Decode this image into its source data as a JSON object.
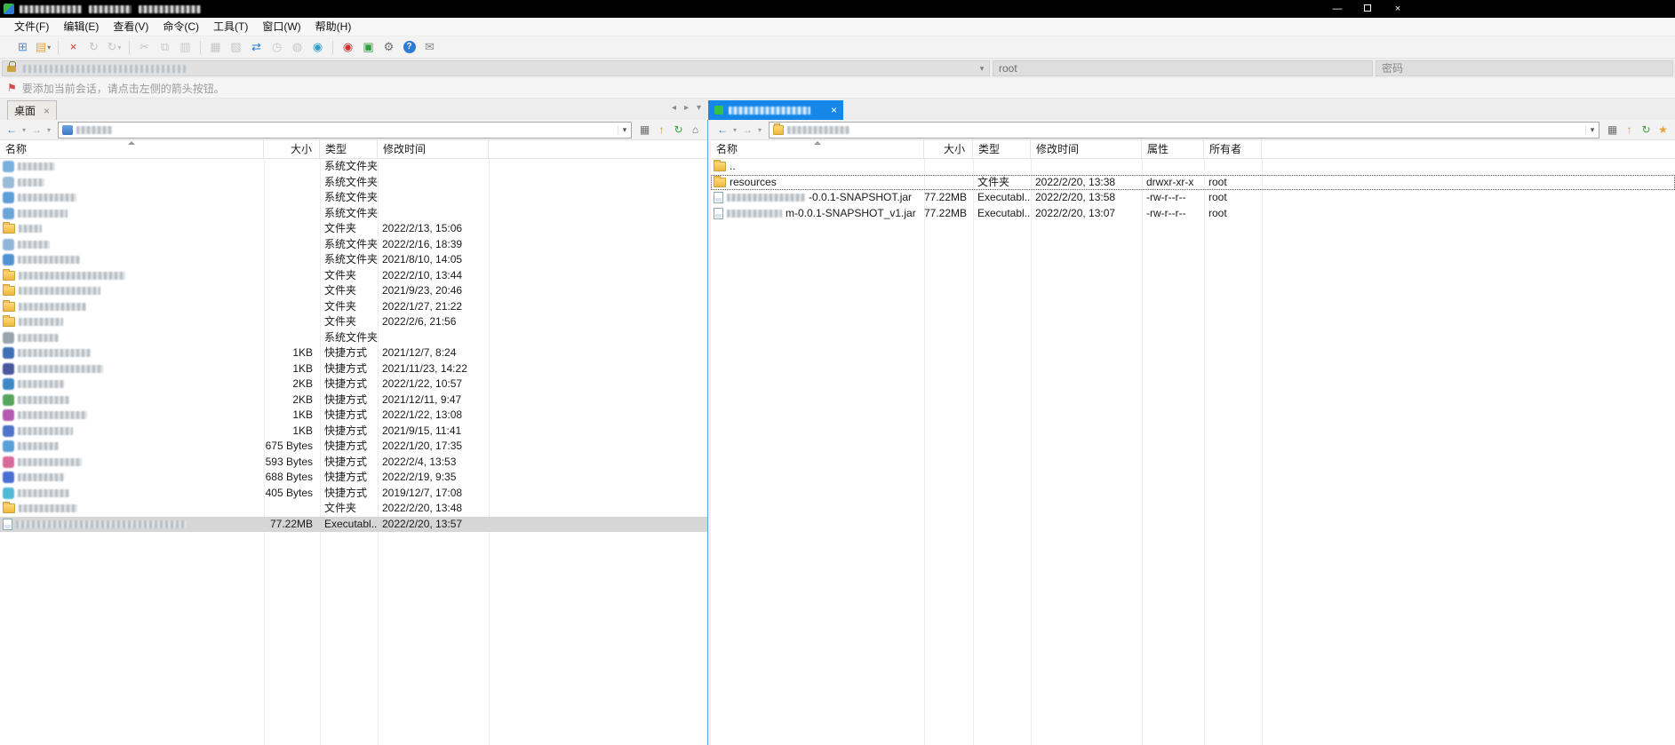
{
  "window": {
    "controls": {
      "minimize": "—",
      "maximize": "",
      "close": "×"
    }
  },
  "menu": [
    "文件(F)",
    "编辑(E)",
    "查看(V)",
    "命令(C)",
    "工具(T)",
    "窗口(W)",
    "帮助(H)"
  ],
  "toolbar": {
    "items": [
      {
        "name": "new-session-button",
        "glyph": "⊞",
        "color": "#4a8fd4",
        "enabled": true
      },
      {
        "name": "open-session-button",
        "glyph": "▤",
        "color": "#dfa93e",
        "enabled": true,
        "dropdown": true
      },
      {
        "separator": true
      },
      {
        "name": "disconnect-button",
        "glyph": "×",
        "color": "#cc3333",
        "enabled": true
      },
      {
        "name": "reconnect-button",
        "glyph": "↻",
        "color": "#8a8a8a",
        "enabled": false
      },
      {
        "name": "reconnect-all-button",
        "glyph": "↻",
        "color": "#8a8a8a",
        "enabled": false,
        "dropdown": true
      },
      {
        "separator": true
      },
      {
        "name": "cut-button",
        "glyph": "✂",
        "color": "#8a8a8a",
        "enabled": false
      },
      {
        "name": "copy-button",
        "glyph": "⧉",
        "color": "#8a8a8a",
        "enabled": false
      },
      {
        "name": "paste-button",
        "glyph": "▥",
        "color": "#8a8a8a",
        "enabled": false
      },
      {
        "separator": true
      },
      {
        "name": "properties-button",
        "glyph": "▦",
        "color": "#8a8a8a",
        "enabled": false
      },
      {
        "name": "compare-button",
        "glyph": "▧",
        "color": "#8a8a8a",
        "enabled": false
      },
      {
        "name": "transfer-button",
        "glyph": "⇄",
        "color": "#2e7bd4",
        "enabled": true
      },
      {
        "name": "transfer-queue-button",
        "glyph": "◷",
        "color": "#8a8a8a",
        "enabled": false
      },
      {
        "name": "log-button",
        "glyph": "◍",
        "color": "#8a8a8a",
        "enabled": false
      },
      {
        "name": "synchronize-button",
        "glyph": "◉",
        "color": "#2e9ed4",
        "enabled": true
      },
      {
        "separator": true
      },
      {
        "name": "record-button",
        "glyph": "◉",
        "color": "#cc3333",
        "enabled": true
      },
      {
        "name": "secure-mode-button",
        "glyph": "▣",
        "color": "#2e9e3e",
        "enabled": true
      },
      {
        "name": "options-button",
        "glyph": "⚙",
        "color": "#6e6e6e",
        "enabled": true
      },
      {
        "name": "help-button",
        "glyph": "?",
        "color": "#ffffff",
        "bg": "#2e7bd4",
        "enabled": true
      },
      {
        "name": "feedback-button",
        "glyph": "✉",
        "color": "#8a8a8a",
        "enabled": true
      }
    ]
  },
  "quick_connect": {
    "username": "root",
    "password_placeholder": "密码"
  },
  "notice": {
    "text": "要添加当前会话，请点击左侧的箭头按钮。"
  },
  "tabs": {
    "desktop_label": "桌面"
  },
  "left_pane": {
    "columns": [
      "名称",
      "大小",
      "类型",
      "修改时间"
    ],
    "rows": [
      {
        "icon": "app",
        "color": "#7ab0e0",
        "nrw": 42,
        "size": "",
        "type": "系统文件夹",
        "mtime": ""
      },
      {
        "icon": "app",
        "color": "#9bbbd8",
        "nrw": 30,
        "size": "",
        "type": "系统文件夹",
        "mtime": ""
      },
      {
        "icon": "app",
        "color": "#5e9ed6",
        "nrw": 66,
        "size": "",
        "type": "系统文件夹",
        "mtime": ""
      },
      {
        "icon": "app",
        "color": "#6aa5d8",
        "nrw": 56,
        "size": "",
        "type": "系统文件夹",
        "mtime": ""
      },
      {
        "icon": "folder",
        "nrw": 26,
        "size": "",
        "type": "文件夹",
        "mtime": "2022/2/13, 15:06"
      },
      {
        "icon": "app",
        "color": "#8fb6d9",
        "nrw": 36,
        "size": "",
        "type": "系统文件夹",
        "mtime": "2022/2/16, 18:39"
      },
      {
        "icon": "app",
        "color": "#4f93cf",
        "nrw": 70,
        "size": "",
        "type": "系统文件夹",
        "mtime": "2021/8/10, 14:05"
      },
      {
        "icon": "folder",
        "nrw": 120,
        "size": "",
        "type": "文件夹",
        "mtime": "2022/2/10, 13:44"
      },
      {
        "icon": "folder",
        "nrw": 92,
        "size": "",
        "type": "文件夹",
        "mtime": "2021/9/23, 20:46"
      },
      {
        "icon": "folder",
        "nrw": 76,
        "size": "",
        "type": "文件夹",
        "mtime": "2022/1/27, 21:22"
      },
      {
        "icon": "folder",
        "nrw": 50,
        "size": "",
        "type": "文件夹",
        "mtime": "2022/2/6, 21:56"
      },
      {
        "icon": "app",
        "color": "#9aa4ad",
        "nrw": 46,
        "size": "",
        "type": "系统文件夹",
        "mtime": ""
      },
      {
        "icon": "app",
        "color": "#3f6fb5",
        "nrw": 82,
        "size": "1KB",
        "type": "快捷方式",
        "mtime": "2021/12/7, 8:24"
      },
      {
        "icon": "app",
        "color": "#49589e",
        "nrw": 96,
        "size": "1KB",
        "type": "快捷方式",
        "mtime": "2021/11/23, 14:22"
      },
      {
        "icon": "app",
        "color": "#3f88c5",
        "nrw": 52,
        "size": "2KB",
        "type": "快捷方式",
        "mtime": "2022/1/22, 10:57"
      },
      {
        "icon": "app",
        "color": "#58a55c",
        "nrw": 58,
        "size": "2KB",
        "type": "快捷方式",
        "mtime": "2021/12/11, 9:47"
      },
      {
        "icon": "app",
        "color": "#b55ab0",
        "nrw": 78,
        "size": "1KB",
        "type": "快捷方式",
        "mtime": "2022/1/22, 13:08"
      },
      {
        "icon": "app",
        "color": "#4f74c9",
        "nrw": 62,
        "size": "1KB",
        "type": "快捷方式",
        "mtime": "2021/9/15, 11:41"
      },
      {
        "icon": "app",
        "color": "#58a0d8",
        "nrw": 46,
        "size": "675 Bytes",
        "type": "快捷方式",
        "mtime": "2022/1/20, 17:35"
      },
      {
        "icon": "app",
        "color": "#d86a9a",
        "nrw": 72,
        "size": "593 Bytes",
        "type": "快捷方式",
        "mtime": "2022/2/4, 13:53"
      },
      {
        "icon": "app",
        "color": "#4a6fd0",
        "nrw": 52,
        "size": "688 Bytes",
        "type": "快捷方式",
        "mtime": "2022/2/19, 9:35"
      },
      {
        "icon": "app",
        "color": "#52b8d8",
        "nrw": 58,
        "size": "405 Bytes",
        "type": "快捷方式",
        "mtime": "2019/12/7, 17:08"
      },
      {
        "icon": "folder",
        "nrw": 66,
        "size": "",
        "type": "文件夹",
        "mtime": "2022/2/20, 13:48"
      },
      {
        "icon": "file",
        "nrw": 192,
        "size": "77.22MB",
        "type": "Executabl...",
        "mtime": "2022/2/20, 13:57",
        "selected": true
      }
    ]
  },
  "right_pane": {
    "columns": [
      "名称",
      "大小",
      "类型",
      "修改时间",
      "属性",
      "所有者"
    ],
    "rows": [
      {
        "icon": "folder",
        "name": "..",
        "size": "",
        "type": "",
        "mtime": "",
        "attrs": "",
        "owner": ""
      },
      {
        "icon": "folder",
        "name": "resources",
        "size": "",
        "type": "文件夹",
        "mtime": "2022/2/20, 13:38",
        "attrs": "drwxr-xr-x",
        "owner": "root",
        "focused": true
      },
      {
        "icon": "file",
        "nrw": 88,
        "name": "-0.0.1-SNAPSHOT.jar",
        "size": "77.22MB",
        "type": "Executabl...",
        "mtime": "2022/2/20, 13:58",
        "attrs": "-rw-r--r--",
        "owner": "root"
      },
      {
        "icon": "file",
        "nrw": 62,
        "name": "m-0.0.1-SNAPSHOT_v1.jar",
        "size": "77.22MB",
        "type": "Executabl...",
        "mtime": "2022/2/20, 13:07",
        "attrs": "-rw-r--r--",
        "owner": "root"
      }
    ]
  }
}
